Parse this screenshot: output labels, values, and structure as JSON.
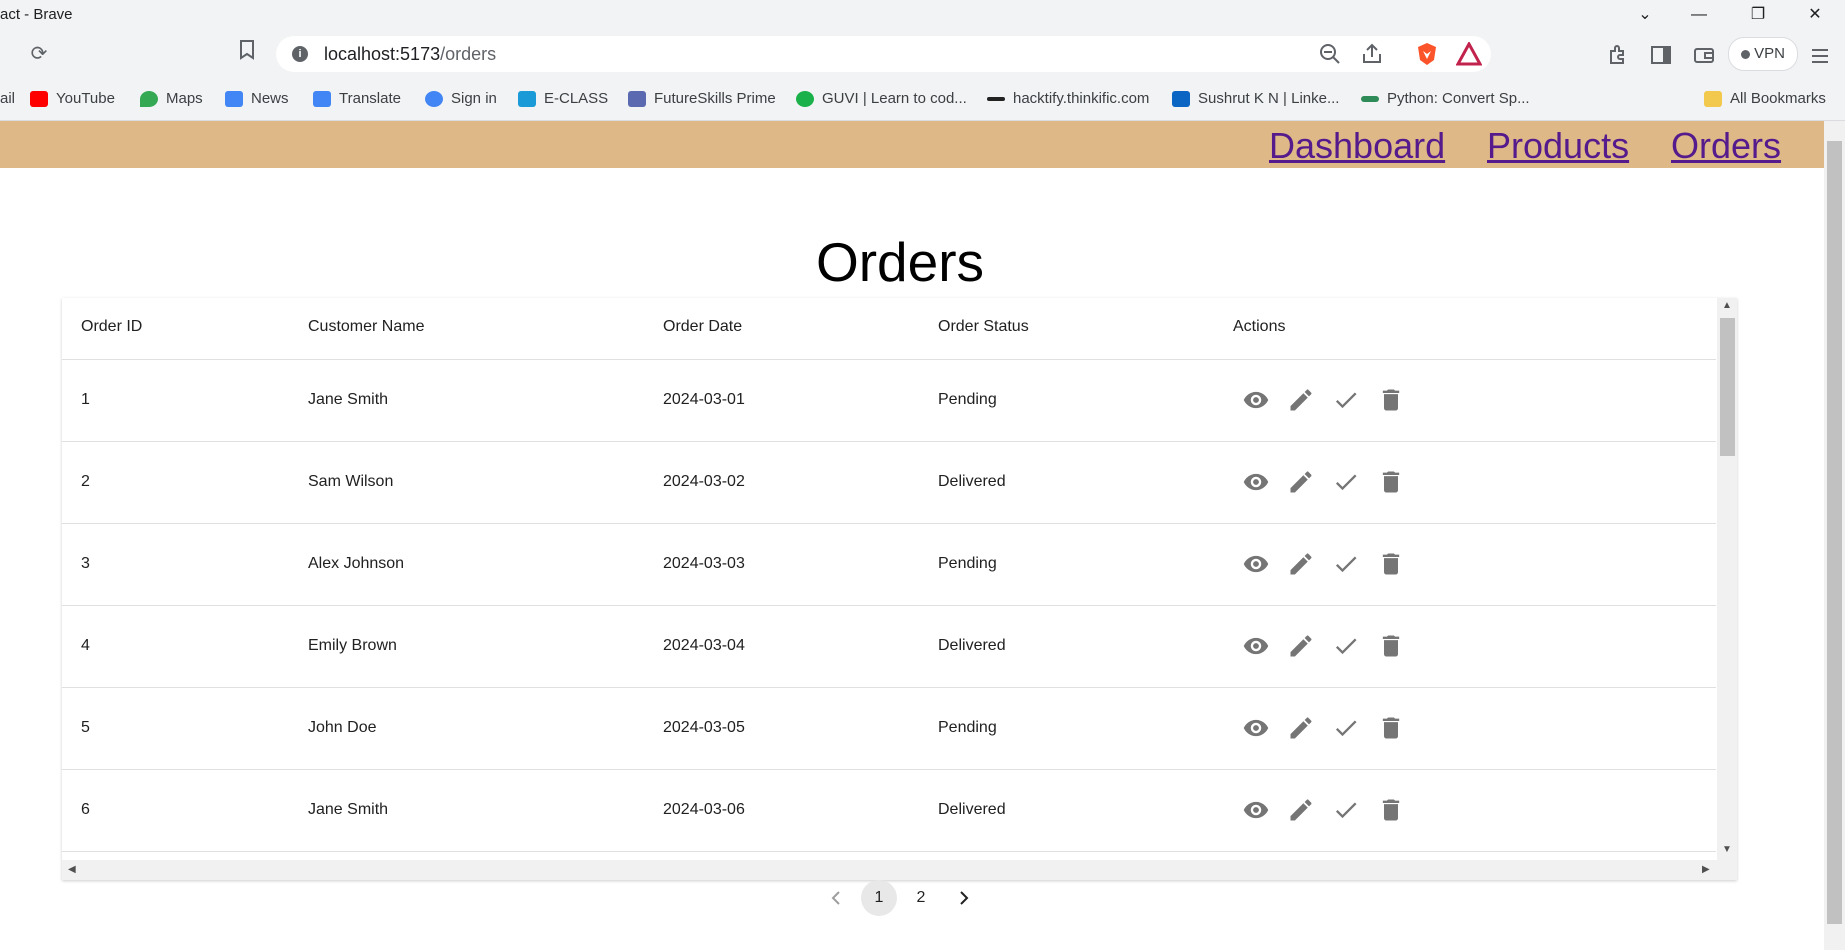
{
  "window": {
    "title": "act - Brave"
  },
  "toolbar": {
    "url_host": "localhost:5173",
    "url_path": "/orders",
    "vpn_label": "VPN"
  },
  "bookmarks": [
    {
      "label": "ail",
      "color": "#ea4335"
    },
    {
      "label": "YouTube",
      "color": "#ff0000"
    },
    {
      "label": "Maps",
      "color": "#34a853"
    },
    {
      "label": "News",
      "color": "#4285f4"
    },
    {
      "label": "Translate",
      "color": "#4285f4"
    },
    {
      "label": "Sign in",
      "color": "#4285f4"
    },
    {
      "label": "E-CLASS",
      "color": "#1a9bd7"
    },
    {
      "label": "FutureSkills Prime",
      "color": "#5b6ab0"
    },
    {
      "label": "GUVI | Learn to cod...",
      "color": "#1ab14a"
    },
    {
      "label": "hacktify.thinkific.com",
      "color": "#222222"
    },
    {
      "label": "Sushrut K N | Linke...",
      "color": "#0a66c2"
    },
    {
      "label": "Python: Convert Sp...",
      "color": "#2e8b57"
    },
    {
      "label": "All Bookmarks",
      "color": "#f2c94c"
    }
  ],
  "nav": {
    "dashboard": "Dashboard",
    "products": "Products",
    "orders": "Orders"
  },
  "page": {
    "title": "Orders"
  },
  "table": {
    "columns": [
      "Order ID",
      "Customer Name",
      "Order Date",
      "Order Status",
      "Actions"
    ],
    "rows": [
      {
        "id": "1",
        "customer": "Jane Smith",
        "date": "2024-03-01",
        "status": "Pending"
      },
      {
        "id": "2",
        "customer": "Sam Wilson",
        "date": "2024-03-02",
        "status": "Delivered"
      },
      {
        "id": "3",
        "customer": "Alex Johnson",
        "date": "2024-03-03",
        "status": "Pending"
      },
      {
        "id": "4",
        "customer": "Emily Brown",
        "date": "2024-03-04",
        "status": "Delivered"
      },
      {
        "id": "5",
        "customer": "John Doe",
        "date": "2024-03-05",
        "status": "Pending"
      },
      {
        "id": "6",
        "customer": "Jane Smith",
        "date": "2024-03-06",
        "status": "Delivered"
      }
    ],
    "action_icons": [
      "eye-icon",
      "pencil-icon",
      "check-icon",
      "trash-icon"
    ],
    "icon_color": "#757575"
  },
  "pagination": {
    "pages": [
      "1",
      "2"
    ],
    "current": "1"
  },
  "colors": {
    "navbar": "#deb887",
    "link": "#551a8b"
  }
}
